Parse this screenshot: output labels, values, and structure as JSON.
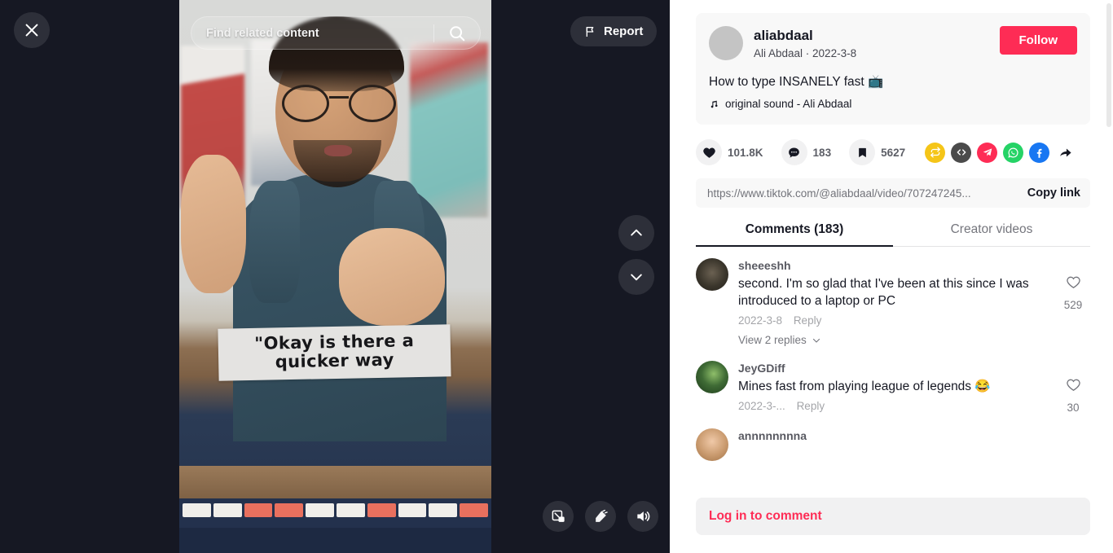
{
  "video_overlay": {
    "close_icon": "close-icon",
    "search_placeholder": "Find related content",
    "search_icon": "search-icon",
    "report_label": "Report",
    "report_icon": "flag-icon",
    "nav_up_icon": "chevron-up-icon",
    "nav_down_icon": "chevron-down-icon",
    "controls": [
      {
        "icon": "picture-in-picture-icon"
      },
      {
        "icon": "clear-display-icon"
      },
      {
        "icon": "volume-on-icon"
      }
    ],
    "caption_line_1": "\"Okay is there a",
    "caption_line_2": "quicker way"
  },
  "info": {
    "username": "aliabdaal",
    "subline": "Ali Abdaal · 2022-3-8",
    "follow_label": "Follow",
    "description": "How to type INSANELY fast 📺",
    "music_icon": "music-note-icon",
    "music": "original sound - Ali Abdaal"
  },
  "stats": {
    "likes": "101.8K",
    "comments": "183",
    "bookmarks": "5627",
    "like_icon": "heart-icon",
    "comment_icon": "comment-icon",
    "bookmark_icon": "bookmark-icon",
    "share_icons": [
      {
        "name": "repost-icon",
        "color": "#f5c518"
      },
      {
        "name": "embed-code-icon",
        "color": "#4b4b4b"
      },
      {
        "name": "telegram-icon",
        "color": "#fe2c55"
      },
      {
        "name": "whatsapp-icon",
        "color": "#25d366"
      },
      {
        "name": "facebook-icon",
        "color": "#1877f2"
      },
      {
        "name": "share-arrow-icon",
        "color": "#161823"
      }
    ]
  },
  "copy": {
    "url": "https://www.tiktok.com/@aliabdaal/video/707247245...",
    "button_label": "Copy link"
  },
  "tabs": [
    {
      "label": "Comments (183)",
      "active": true
    },
    {
      "label": "Creator videos",
      "active": false
    }
  ],
  "comments": [
    {
      "user": "sheeeshh",
      "text": "second. I'm so glad that I've been at this since I was introduced to a laptop or PC",
      "date": "2022-3-8",
      "reply_label": "Reply",
      "replies_label": "View 2 replies",
      "likes": "529"
    },
    {
      "user": "JeyGDiff",
      "text": "Mines fast from playing league of legends 😂",
      "date": "2022-3-...",
      "reply_label": "Reply",
      "likes": "30"
    },
    {
      "user": "annnnnnnna",
      "text": "",
      "date": "",
      "reply_label": "",
      "likes": ""
    }
  ],
  "login": {
    "prompt": "Log in to comment"
  },
  "colors": {
    "brand_pink": "#fe2c55",
    "dark_bg": "#161823",
    "panel_bg": "#ffffff",
    "card_bg": "#f8f8f8"
  }
}
